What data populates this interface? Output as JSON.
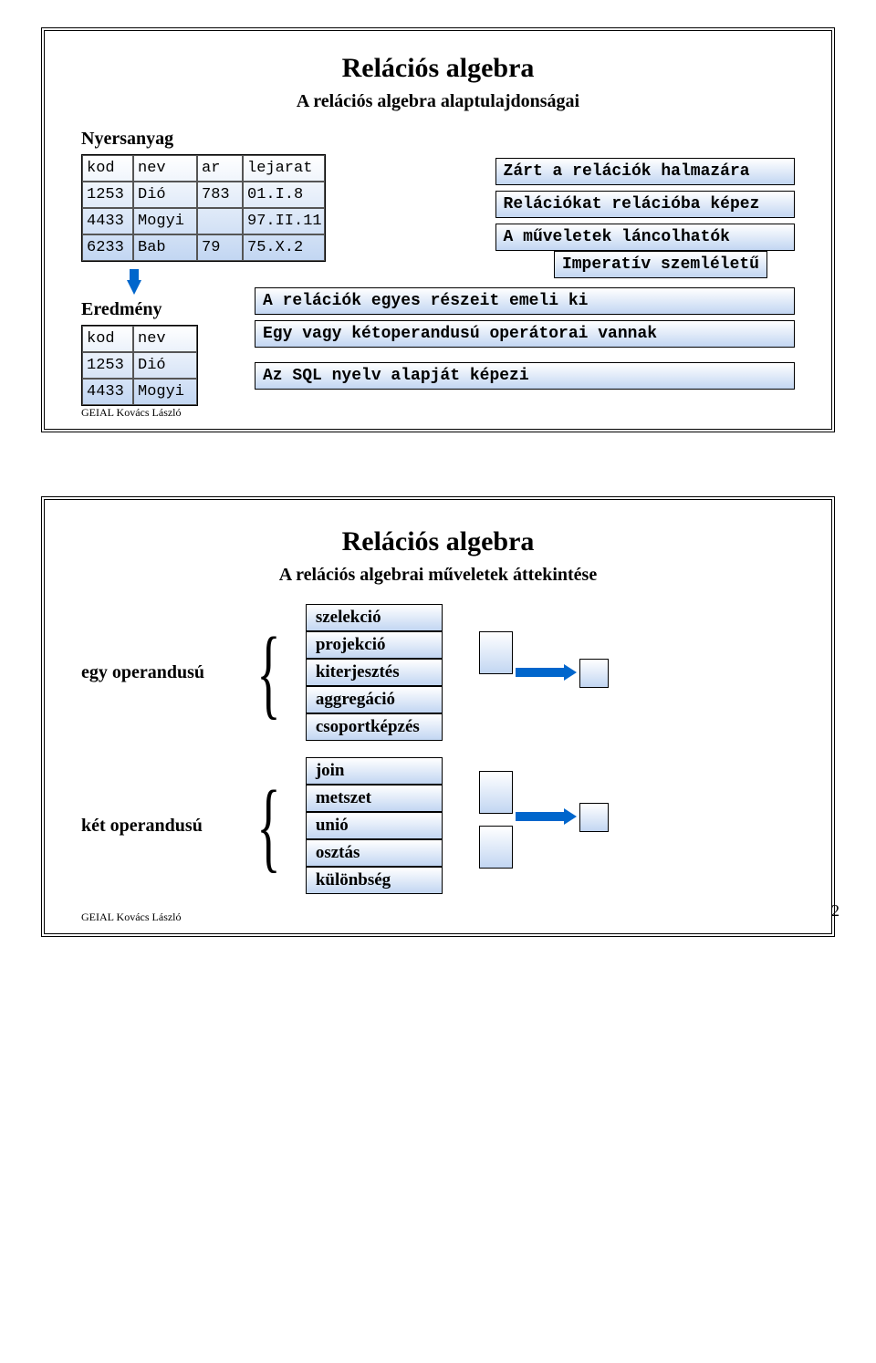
{
  "slide1": {
    "title": "Relációs algebra",
    "subtitle": "A relációs algebra alaptulajdonságai",
    "tableLabel": "Nyersanyag",
    "table": {
      "headers": [
        "kod",
        "nev",
        "ar",
        "lejarat"
      ],
      "rows": [
        [
          "1253",
          "Dió",
          "783",
          "01.I.8"
        ],
        [
          "4433",
          "Mogyi",
          "",
          "97.II.11"
        ],
        [
          "6233",
          "Bab",
          "79",
          "75.X.2"
        ]
      ]
    },
    "resultLabel": "Eredmény",
    "result": {
      "headers": [
        "kod",
        "nev"
      ],
      "rows": [
        [
          "1253",
          "Dió"
        ],
        [
          "4433",
          "Mogyi"
        ]
      ]
    },
    "props": [
      "Zárt a relációk halmazára",
      "Relációkat relációba képez",
      "A műveletek láncolhatók"
    ],
    "imperative": "Imperatív szemléletű",
    "wideProps": [
      "A relációk egyes részeit emeli ki",
      "Egy vagy kétoperandusú operátorai vannak",
      "Az SQL nyelv alapját képezi"
    ],
    "footer": "GEIAL Kovács László"
  },
  "slide2": {
    "title": "Relációs algebra",
    "subtitle": "A relációs algebrai műveletek áttekintése",
    "unaryLabel": "egy operandusú",
    "unaryOps": [
      "szelekció",
      "projekció",
      "kiterjesztés",
      "aggregáció",
      "csoportképzés"
    ],
    "binaryLabel": "két operandusú",
    "binaryOps": [
      "join",
      "metszet",
      "unió",
      "osztás",
      "különbség"
    ],
    "footer": "GEIAL Kovács László"
  },
  "pageNumber": "2"
}
